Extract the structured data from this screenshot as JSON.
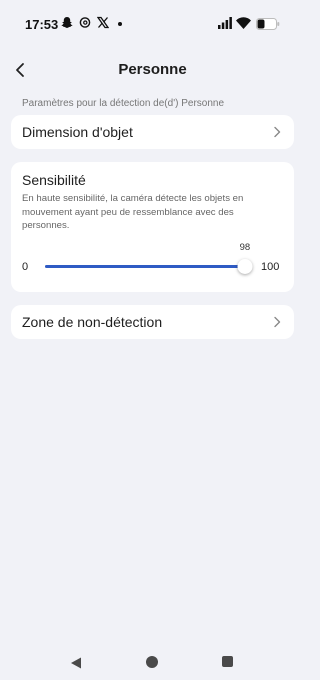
{
  "status_bar": {
    "time": "17:53",
    "icons": [
      "snapchat-icon",
      "threads-icon",
      "x-icon",
      "notification-dot",
      "signal-icon",
      "wifi-icon",
      "battery-icon"
    ]
  },
  "header": {
    "title": "Personne",
    "back_icon": "chevron-left-icon"
  },
  "section_caption": "Paramètres pour la détection de(d') Personne",
  "object_dimension": {
    "label": "Dimension d'objet"
  },
  "sensitivity": {
    "title": "Sensibilité",
    "description": "En haute sensibilité, la caméra détecte les objets en mouvement ayant peu de ressemblance avec des personnes.",
    "min_label": "0",
    "max_label": "100",
    "value": 98,
    "value_label": "98"
  },
  "no_detection_zone": {
    "label": "Zone de non-détection"
  },
  "nav_bar": {
    "icons": [
      "nav-back-icon",
      "nav-home-icon",
      "nav-recents-icon"
    ]
  },
  "colors": {
    "background": "#f1f2f7",
    "card": "#ffffff",
    "accent": "#2f5bc4"
  }
}
